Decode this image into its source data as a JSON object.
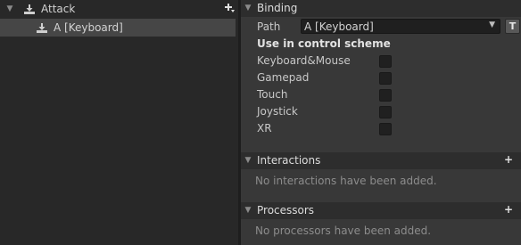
{
  "tree": {
    "action_label": "Attack",
    "action_icon": "input-action-icon",
    "add_icon": "add-binding-icon",
    "binding_label": "A [Keyboard]",
    "binding_icon": "input-binding-icon"
  },
  "binding_section": {
    "title": "Binding",
    "path_label": "Path",
    "path_value": "A [Keyboard]",
    "t_button": "T",
    "scheme_heading": "Use in control scheme",
    "schemes": [
      {
        "label": "Keyboard&Mouse",
        "checked": false
      },
      {
        "label": "Gamepad",
        "checked": false
      },
      {
        "label": "Touch",
        "checked": false
      },
      {
        "label": "Joystick",
        "checked": false
      },
      {
        "label": "XR",
        "checked": false
      }
    ]
  },
  "interactions_section": {
    "title": "Interactions",
    "add_label": "+",
    "empty_text": "No interactions have been added."
  },
  "processors_section": {
    "title": "Processors",
    "add_label": "+",
    "empty_text": "No processors have been added."
  }
}
